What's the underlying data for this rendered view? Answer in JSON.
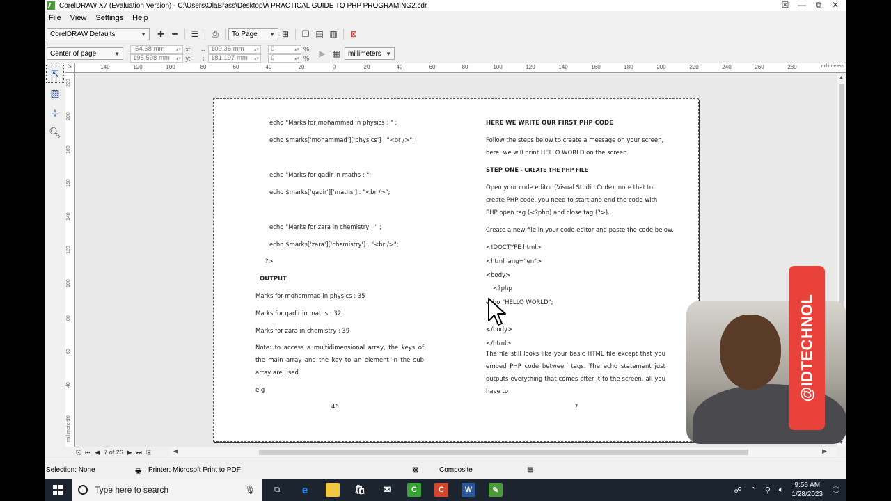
{
  "window": {
    "title": "CorelDRAW X7 (Evaluation Version) - C:\\Users\\OlaBrass\\Desktop\\A PRACTICAL GUIDE TO PHP PROGRAMING2.cdr",
    "controls": [
      "☒",
      "—",
      "⧉",
      "✕"
    ]
  },
  "menu": [
    "File",
    "View",
    "Settings",
    "Help"
  ],
  "toolbar": {
    "preset": "CorelDRAW Defaults",
    "view_mode": "To Page",
    "anchor": "Center of page",
    "x_value": "-54.68 mm",
    "y_value": "195.598 mm",
    "x_label": "x:",
    "y_label": "y:",
    "width_value": "109.36 mm",
    "height_value": "181.197 mm",
    "scale_x": "0",
    "scale_y": "0",
    "pct": "%",
    "units": "millimeters"
  },
  "ruler": {
    "h_labels": [
      "140",
      "120",
      "100",
      "80",
      "60",
      "40",
      "20",
      "0",
      "20",
      "40",
      "60",
      "80",
      "100",
      "120",
      "140",
      "160",
      "180",
      "200",
      "220",
      "240",
      "260",
      "280"
    ],
    "h_unit": "millimeters",
    "v_labels": [
      "220",
      "200",
      "180",
      "160",
      "140",
      "120",
      "100",
      "80",
      "60",
      "40",
      "20"
    ],
    "v_unit": "millimeters"
  },
  "page_left": {
    "lines": [
      "echo \"Marks for mohammad in physics : \" ;",
      "echo $marks['mohammad']['physics'] . \"<br />\";",
      "echo \"Marks for qadir in maths : \";",
      "echo $marks['qadir']['maths'] . \"<br />\";",
      "echo \"Marks for zara in chemistry : \" ;",
      "echo $marks['zara']['chemistry'] . \"<br />\";",
      "?>"
    ],
    "output_heading": "OUTPUT",
    "output_lines": [
      "Marks for mohammad in physics : 35",
      "Marks for qadir in maths : 32",
      "Marks for zara in chemistry : 39"
    ],
    "note": "Note: to access a multidimensional array, the keys of the main array and the key to an element in the sub array are used.",
    "eg": "e.g",
    "page_number": "46"
  },
  "page_right": {
    "heading": "HERE WE WRITE OUR FIRST PHP CODE",
    "intro": "Follow the steps below to create a message on your screen, here, we will print HELLO WORLD on the screen.",
    "step_prefix": "STEP ONE",
    "step_title": " - CREATE THE PHP FILE",
    "para1": "Open your code editor (Visual Studio Code), note that to create PHP code, you need to start and end the code with PHP open tag (<?php) and close tag (?>).",
    "para2": "Create a new file in your code editor and paste the code below.",
    "code": [
      "<!DOCTYPE html>",
      "<html lang=\"en\">",
      "<body>",
      "<?php",
      "echo \"HELLO WORLD\";",
      "</body>",
      "</html>"
    ],
    "para3": "The file still looks like your basic HTML file except that you embed PHP code between tags. The echo statement just outputs everything that comes after it to the screen. all you have to",
    "page_number": "7"
  },
  "page_nav": {
    "label": "7 of 26"
  },
  "status": {
    "selection": "Selection: None",
    "printer": "Printer: Microsoft Print to PDF",
    "composite": "Composite"
  },
  "taskbar": {
    "search_placeholder": "Type here to search",
    "time": "9:56 AM",
    "date": "1/28/2023"
  },
  "overlay": {
    "handle": "@IDTECHNOL"
  },
  "colors": {
    "accent": "#e8423a",
    "taskbar": "#1c2430",
    "chrome": "#f0f0f0"
  }
}
